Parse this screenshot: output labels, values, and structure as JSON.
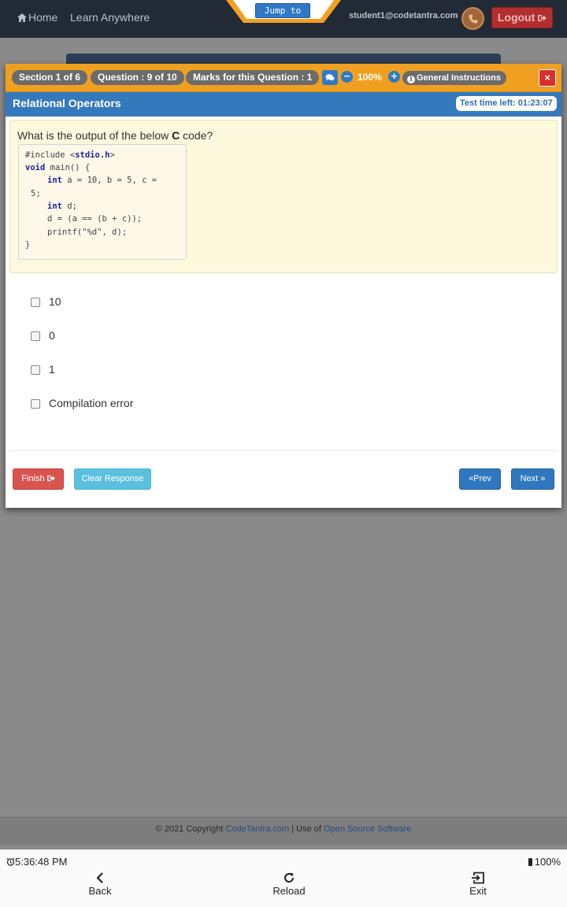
{
  "nav": {
    "home": "Home",
    "learn": "Learn Anywhere",
    "jump_to": "Jump to",
    "user_email": "student1@codetantra.com",
    "logout": "Logout"
  },
  "toolbar": {
    "section": "Section 1 of 6",
    "question": "Question : 9 of 10",
    "marks": "Marks for this Question : 1",
    "zoom": "100%",
    "general_instructions": "General Instructions",
    "close": "×"
  },
  "header": {
    "topic": "Relational Operators",
    "time_left": "Test time left: 01:23:07"
  },
  "question": {
    "text_before": "What is the output of the below ",
    "text_bold": "C",
    "text_after": " code?",
    "code": {
      "l1_a": "#include <",
      "l1_b": "stdio.h",
      "l1_c": ">",
      "l2_kw": "void",
      "l2_rest": " main() {",
      "l3_kw": "int",
      "l3_rest": " a = 10, b = 5, c =",
      "l4": "5;",
      "l5_kw": "int",
      "l5_rest": " d;",
      "l6": "d = (a == (b + c));",
      "l7": "printf(\"%d\", d);",
      "l8": "}"
    }
  },
  "options": [
    "10",
    "0",
    "1",
    "Compilation error"
  ],
  "buttons": {
    "finish": "Finish",
    "clear": "Clear Response",
    "prev": "Prev",
    "next": "Next"
  },
  "footer": {
    "prefix": "© 2021 Copyright ",
    "link1": "CodeTantra.com",
    "middle": " | Use of ",
    "link2": "Open Source Software"
  },
  "device": {
    "clock": "5:36:48 PM",
    "battery": "100%",
    "back": "Back",
    "reload": "Reload",
    "exit": "Exit"
  },
  "colors": {
    "orange_bar": "#f0a020",
    "blue_bar": "#3579bd",
    "danger": "#d9534f",
    "info": "#5bc0de",
    "primary": "#2f78bf"
  }
}
